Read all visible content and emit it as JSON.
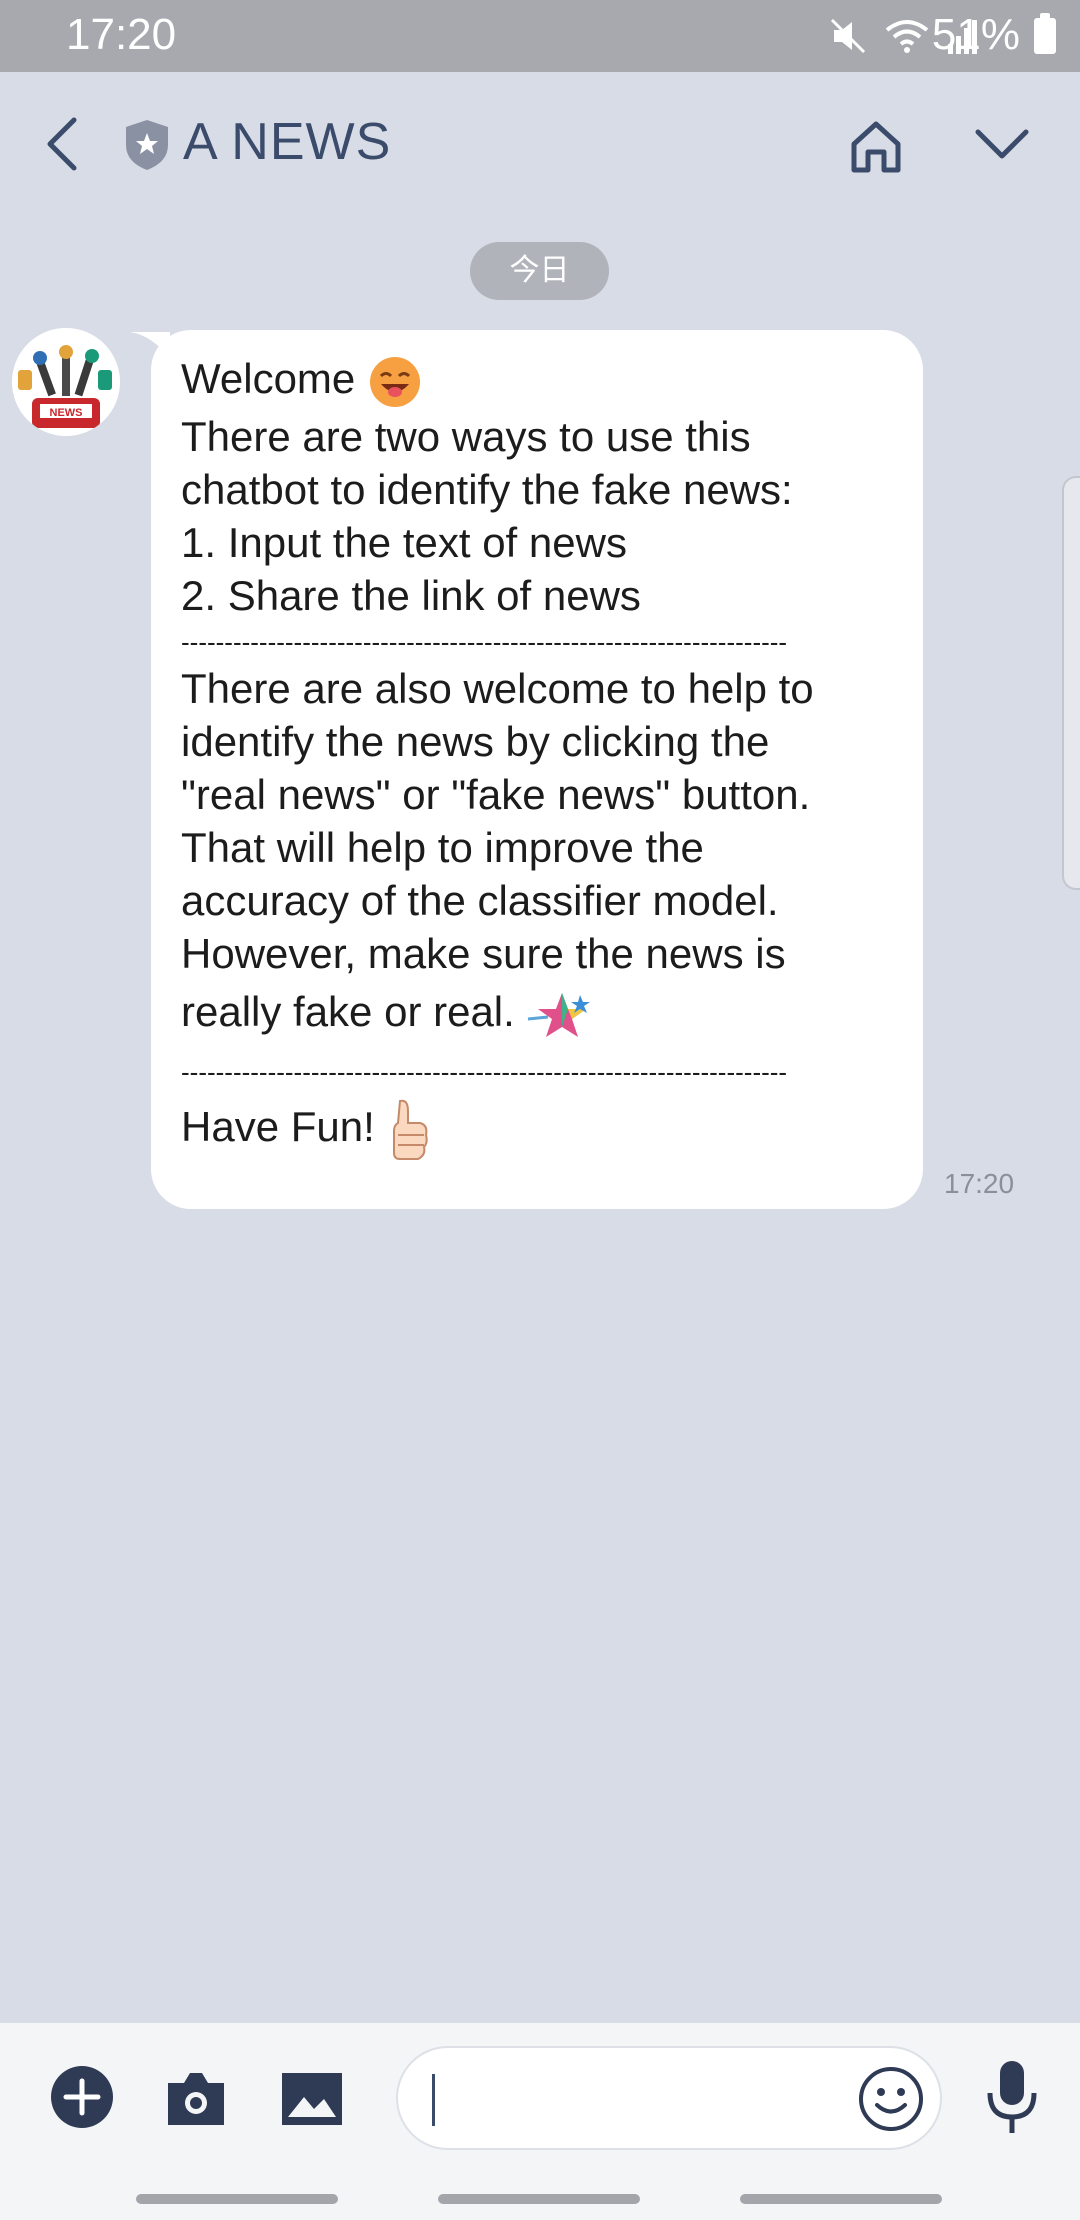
{
  "status_bar": {
    "time": "17:20",
    "battery": "51%"
  },
  "header": {
    "title": "A NEWS"
  },
  "date_pill": "今日",
  "message": {
    "lines_intro": [
      "Welcome",
      "There are two ways to use this",
      "chatbot to identify the fake news:",
      "1. Input the text of news",
      "2. Share the link of news"
    ],
    "divider": "----------------------------------------------------------------------",
    "lines_body": [
      "There are also welcome to help to",
      "identify the news by clicking the",
      "\"real news\" or \"fake news\" button.",
      "That will help to improve the",
      "accuracy of the classifier model.",
      "However, make sure the news is",
      "really fake or real."
    ],
    "closing": "Have Fun!",
    "time": "17:20"
  },
  "avatar_label": "NEWS",
  "colors": {
    "header_text": "#3b4b6b",
    "background": "#d8dce6",
    "bubble": "#ffffff"
  },
  "icons": [
    "back-icon",
    "shield-star-icon",
    "home-icon",
    "chevron-down-icon",
    "plus-icon",
    "camera-icon",
    "image-icon",
    "emoji-icon",
    "mic-icon"
  ]
}
